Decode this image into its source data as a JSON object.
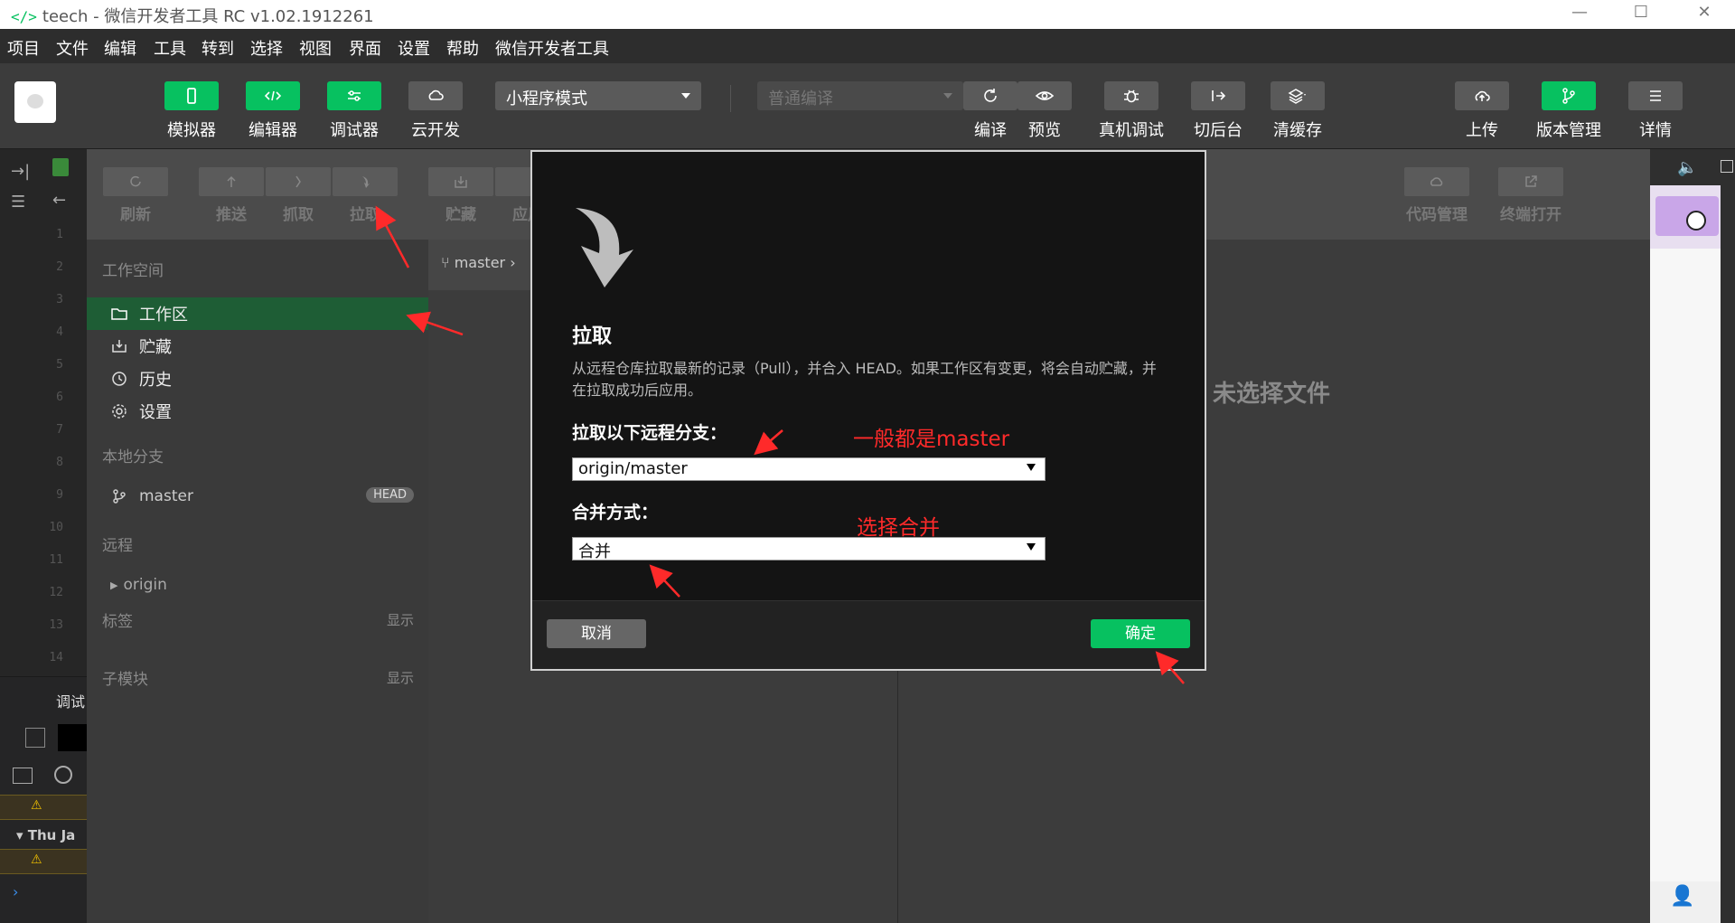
{
  "window": {
    "title": "teech - 微信开发者工具 RC v1.02.1912261",
    "logo": "</>"
  },
  "menu": [
    "项目",
    "文件",
    "编辑",
    "工具",
    "转到",
    "选择",
    "视图",
    "界面",
    "设置",
    "帮助",
    "微信开发者工具"
  ],
  "toolbar": {
    "simulator": "模拟器",
    "editor": "编辑器",
    "debugger": "调试器",
    "cloud": "云开发",
    "mode": "小程序模式",
    "compile_mode": "普通编译",
    "compile": "编译",
    "preview": "预览",
    "remote_debug": "真机调试",
    "background": "切后台",
    "clear_cache": "清缓存",
    "upload": "上传",
    "version": "版本管理",
    "details": "详情"
  },
  "git_toolbar": {
    "refresh": "刷新",
    "push": "推送",
    "fetch": "抓取",
    "pull": "拉取",
    "stash": "贮藏",
    "apply": "应用",
    "code_mgmt": "代码管理",
    "terminal": "终端打开"
  },
  "git_sidebar": {
    "workspace_title": "工作空间",
    "workspace_items": [
      "工作区",
      "贮藏",
      "历史",
      "设置"
    ],
    "local_title": "本地分支",
    "local_branch": "master",
    "head_badge": "HEAD",
    "remote_title": "远程",
    "remote_item": "origin",
    "tags_title": "标签",
    "tags_action": "显示",
    "submodule_title": "子模块",
    "submodule_action": "显示"
  },
  "branch_bar": {
    "branch": "master"
  },
  "content": {
    "no_file": "未选择文件"
  },
  "dialog": {
    "title": "拉取",
    "description": "从远程仓库拉取最新的记录（Pull），并合入 HEAD。如果工作区有变更，将会自动贮藏，并在拉取成功后应用。",
    "branch_label": "拉取以下远程分支：",
    "branch_value": "origin/master",
    "merge_label": "合并方式：",
    "merge_value": "合并",
    "cancel": "取消",
    "ok": "确定"
  },
  "annotations": {
    "branch_note": "一般都是master",
    "merge_note": "选择合并"
  },
  "left_strip": {
    "line_numbers": [
      "1",
      "2",
      "3",
      "4",
      "5",
      "6",
      "7",
      "8",
      "9",
      "10",
      "11",
      "12",
      "13",
      "14"
    ],
    "debug_tab": "调试",
    "log_date": "Thu Ja"
  },
  "colors": {
    "accent": "#07c160",
    "annotation": "#ff2a2a",
    "active_row": "#1e5d35"
  }
}
